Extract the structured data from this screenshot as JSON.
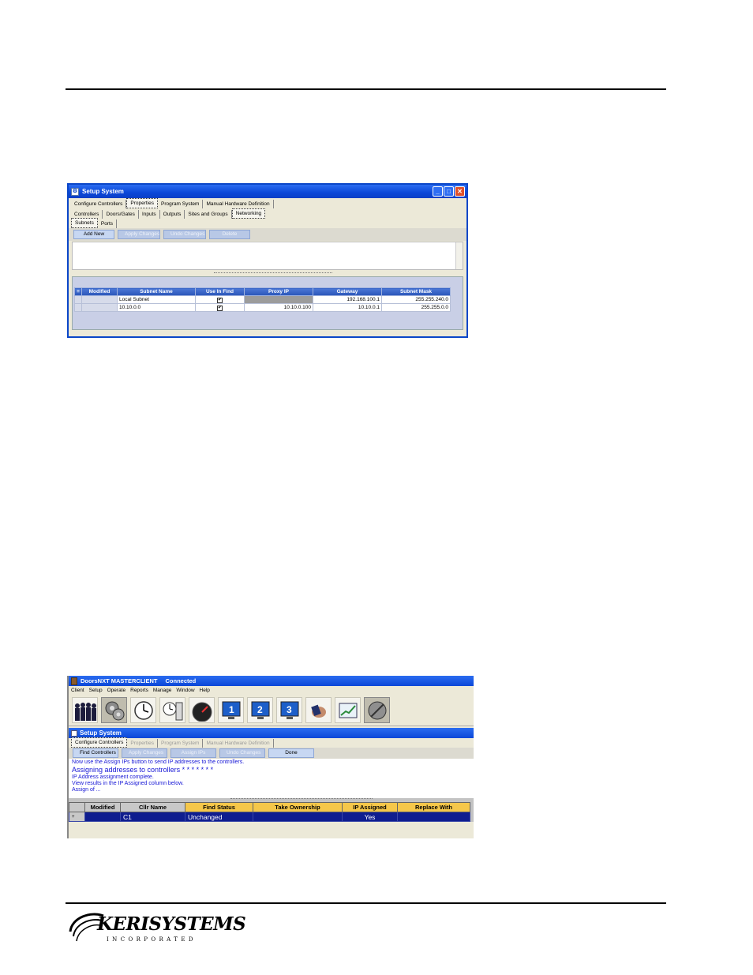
{
  "window1": {
    "title": "Setup System",
    "top_tabs": [
      "Configure Controllers",
      "Properties",
      "Program System",
      "Manual Hardware Definition"
    ],
    "sub_tabs": [
      "Controllers",
      "Doors/Gates",
      "Inputs",
      "Outputs",
      "Sites and Groups",
      "Networking"
    ],
    "inner_tabs": [
      "Subnets",
      "Ports"
    ],
    "buttons": [
      "Add New",
      "Apply Changes",
      "Undo Changes",
      "Delete"
    ],
    "columns": [
      "Modified",
      "Subnet Name",
      "Use In Find",
      "Proxy IP",
      "Gateway",
      "Subnet Mask"
    ],
    "rows": [
      {
        "modified": "",
        "subnet_name": "Local Subnet",
        "use_in_find": "✔",
        "proxy_ip": "",
        "gateway": "192.168.100.1",
        "subnet_mask": "255.255.240.0"
      },
      {
        "modified": "",
        "subnet_name": "10.10.0.0",
        "use_in_find": "✔",
        "proxy_ip": "10.10.0.100",
        "gateway": "10.10.0.1",
        "subnet_mask": "255.255.0.0"
      }
    ]
  },
  "window2": {
    "app_title": "DoorsNXT  MASTERCLIENT",
    "app_status": "Connected",
    "menu": [
      "Client",
      "Setup",
      "Operate",
      "Reports",
      "Manage",
      "Window",
      "Help"
    ],
    "toolbar_icons": [
      "users-icon",
      "gears-icon",
      "clock-icon",
      "clock-door-icon",
      "speedometer-icon",
      "monitor-1-icon",
      "monitor-2-icon",
      "monitor-3-icon",
      "hand-card-icon",
      "trend-chart-icon",
      "no-sound-icon"
    ],
    "title": "Setup System",
    "tabs": [
      "Configure Controllers",
      "Properties",
      "Program System",
      "Manual Hardware Definition"
    ],
    "buttons": [
      "Find Controllers",
      "Apply Changes",
      "Assign IPs",
      "Undo Changes",
      "Done"
    ],
    "messages": [
      "Now use the Assign IPs button to send IP addresses to the controllers.",
      "Assigning addresses to controllers  * * * * * * *",
      "IP Address assignment complete.",
      "View results in the IP Assigned column below.",
      "Assign of ..."
    ],
    "columns": [
      "Modified",
      "Cllr Name",
      "Find Status",
      "Take Ownership",
      "IP Assigned",
      "Replace With"
    ],
    "row": {
      "expander": "+",
      "modified": "",
      "cllr_name": "C1",
      "find_status": "Unchanged",
      "take_ownership": "",
      "ip_assigned": "Yes",
      "replace_with": ""
    }
  },
  "logo": {
    "name": "KERISYSTEMS",
    "subtitle": "INCORPORATED"
  }
}
